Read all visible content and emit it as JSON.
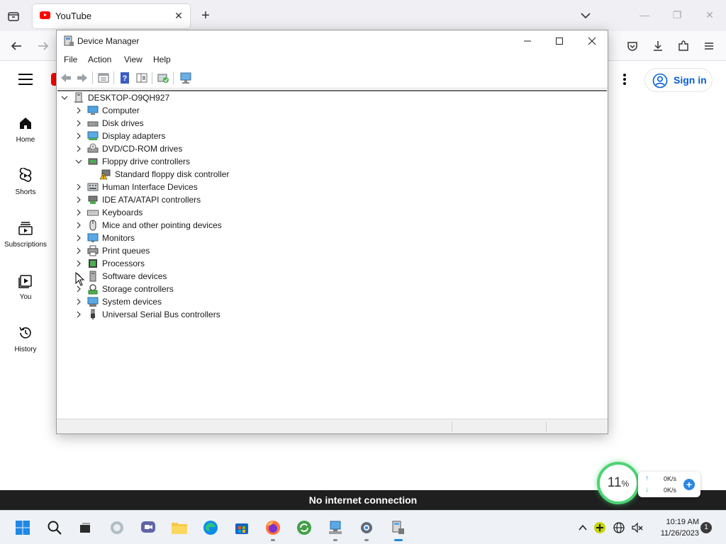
{
  "browser": {
    "tab_title": "YouTube",
    "new_tab_label": "+"
  },
  "youtube": {
    "sidebar": [
      {
        "label": "Home",
        "icon": "home-icon"
      },
      {
        "label": "Shorts",
        "icon": "shorts-icon"
      },
      {
        "label": "Subscriptions",
        "icon": "subscriptions-icon"
      },
      {
        "label": "You",
        "icon": "you-icon"
      },
      {
        "label": "History",
        "icon": "history-icon"
      }
    ],
    "sign_in_label": "Sign in",
    "offline_message": "No internet connection"
  },
  "device_manager": {
    "title": "Device Manager",
    "menu": [
      "File",
      "Action",
      "View",
      "Help"
    ],
    "root": "DESKTOP-O9QH927",
    "categories": [
      {
        "label": "Computer",
        "expanded": false
      },
      {
        "label": "Disk drives",
        "expanded": false
      },
      {
        "label": "Display adapters",
        "expanded": false
      },
      {
        "label": "DVD/CD-ROM drives",
        "expanded": false
      },
      {
        "label": "Floppy drive controllers",
        "expanded": true,
        "children": [
          "Standard floppy disk controller"
        ]
      },
      {
        "label": "Human Interface Devices",
        "expanded": false
      },
      {
        "label": "IDE ATA/ATAPI controllers",
        "expanded": false
      },
      {
        "label": "Keyboards",
        "expanded": false
      },
      {
        "label": "Mice and other pointing devices",
        "expanded": false
      },
      {
        "label": "Monitors",
        "expanded": false
      },
      {
        "label": "Print queues",
        "expanded": false
      },
      {
        "label": "Processors",
        "expanded": false
      },
      {
        "label": "Software devices",
        "expanded": false
      },
      {
        "label": "Storage controllers",
        "expanded": false
      },
      {
        "label": "System devices",
        "expanded": false
      },
      {
        "label": "Universal Serial Bus controllers",
        "expanded": false
      }
    ]
  },
  "net_widget": {
    "percent": "11",
    "percent_sign": "%",
    "upload": "0K/s",
    "download": "0K/s"
  },
  "taskbar": {
    "time": "10:19 AM",
    "date": "11/26/2023",
    "notification_count": "1"
  },
  "colors": {
    "youtube_red": "#ff0000",
    "signin_blue": "#065fd4",
    "offline_bar": "#1f1f1f",
    "widget_green": "#4cd374"
  }
}
